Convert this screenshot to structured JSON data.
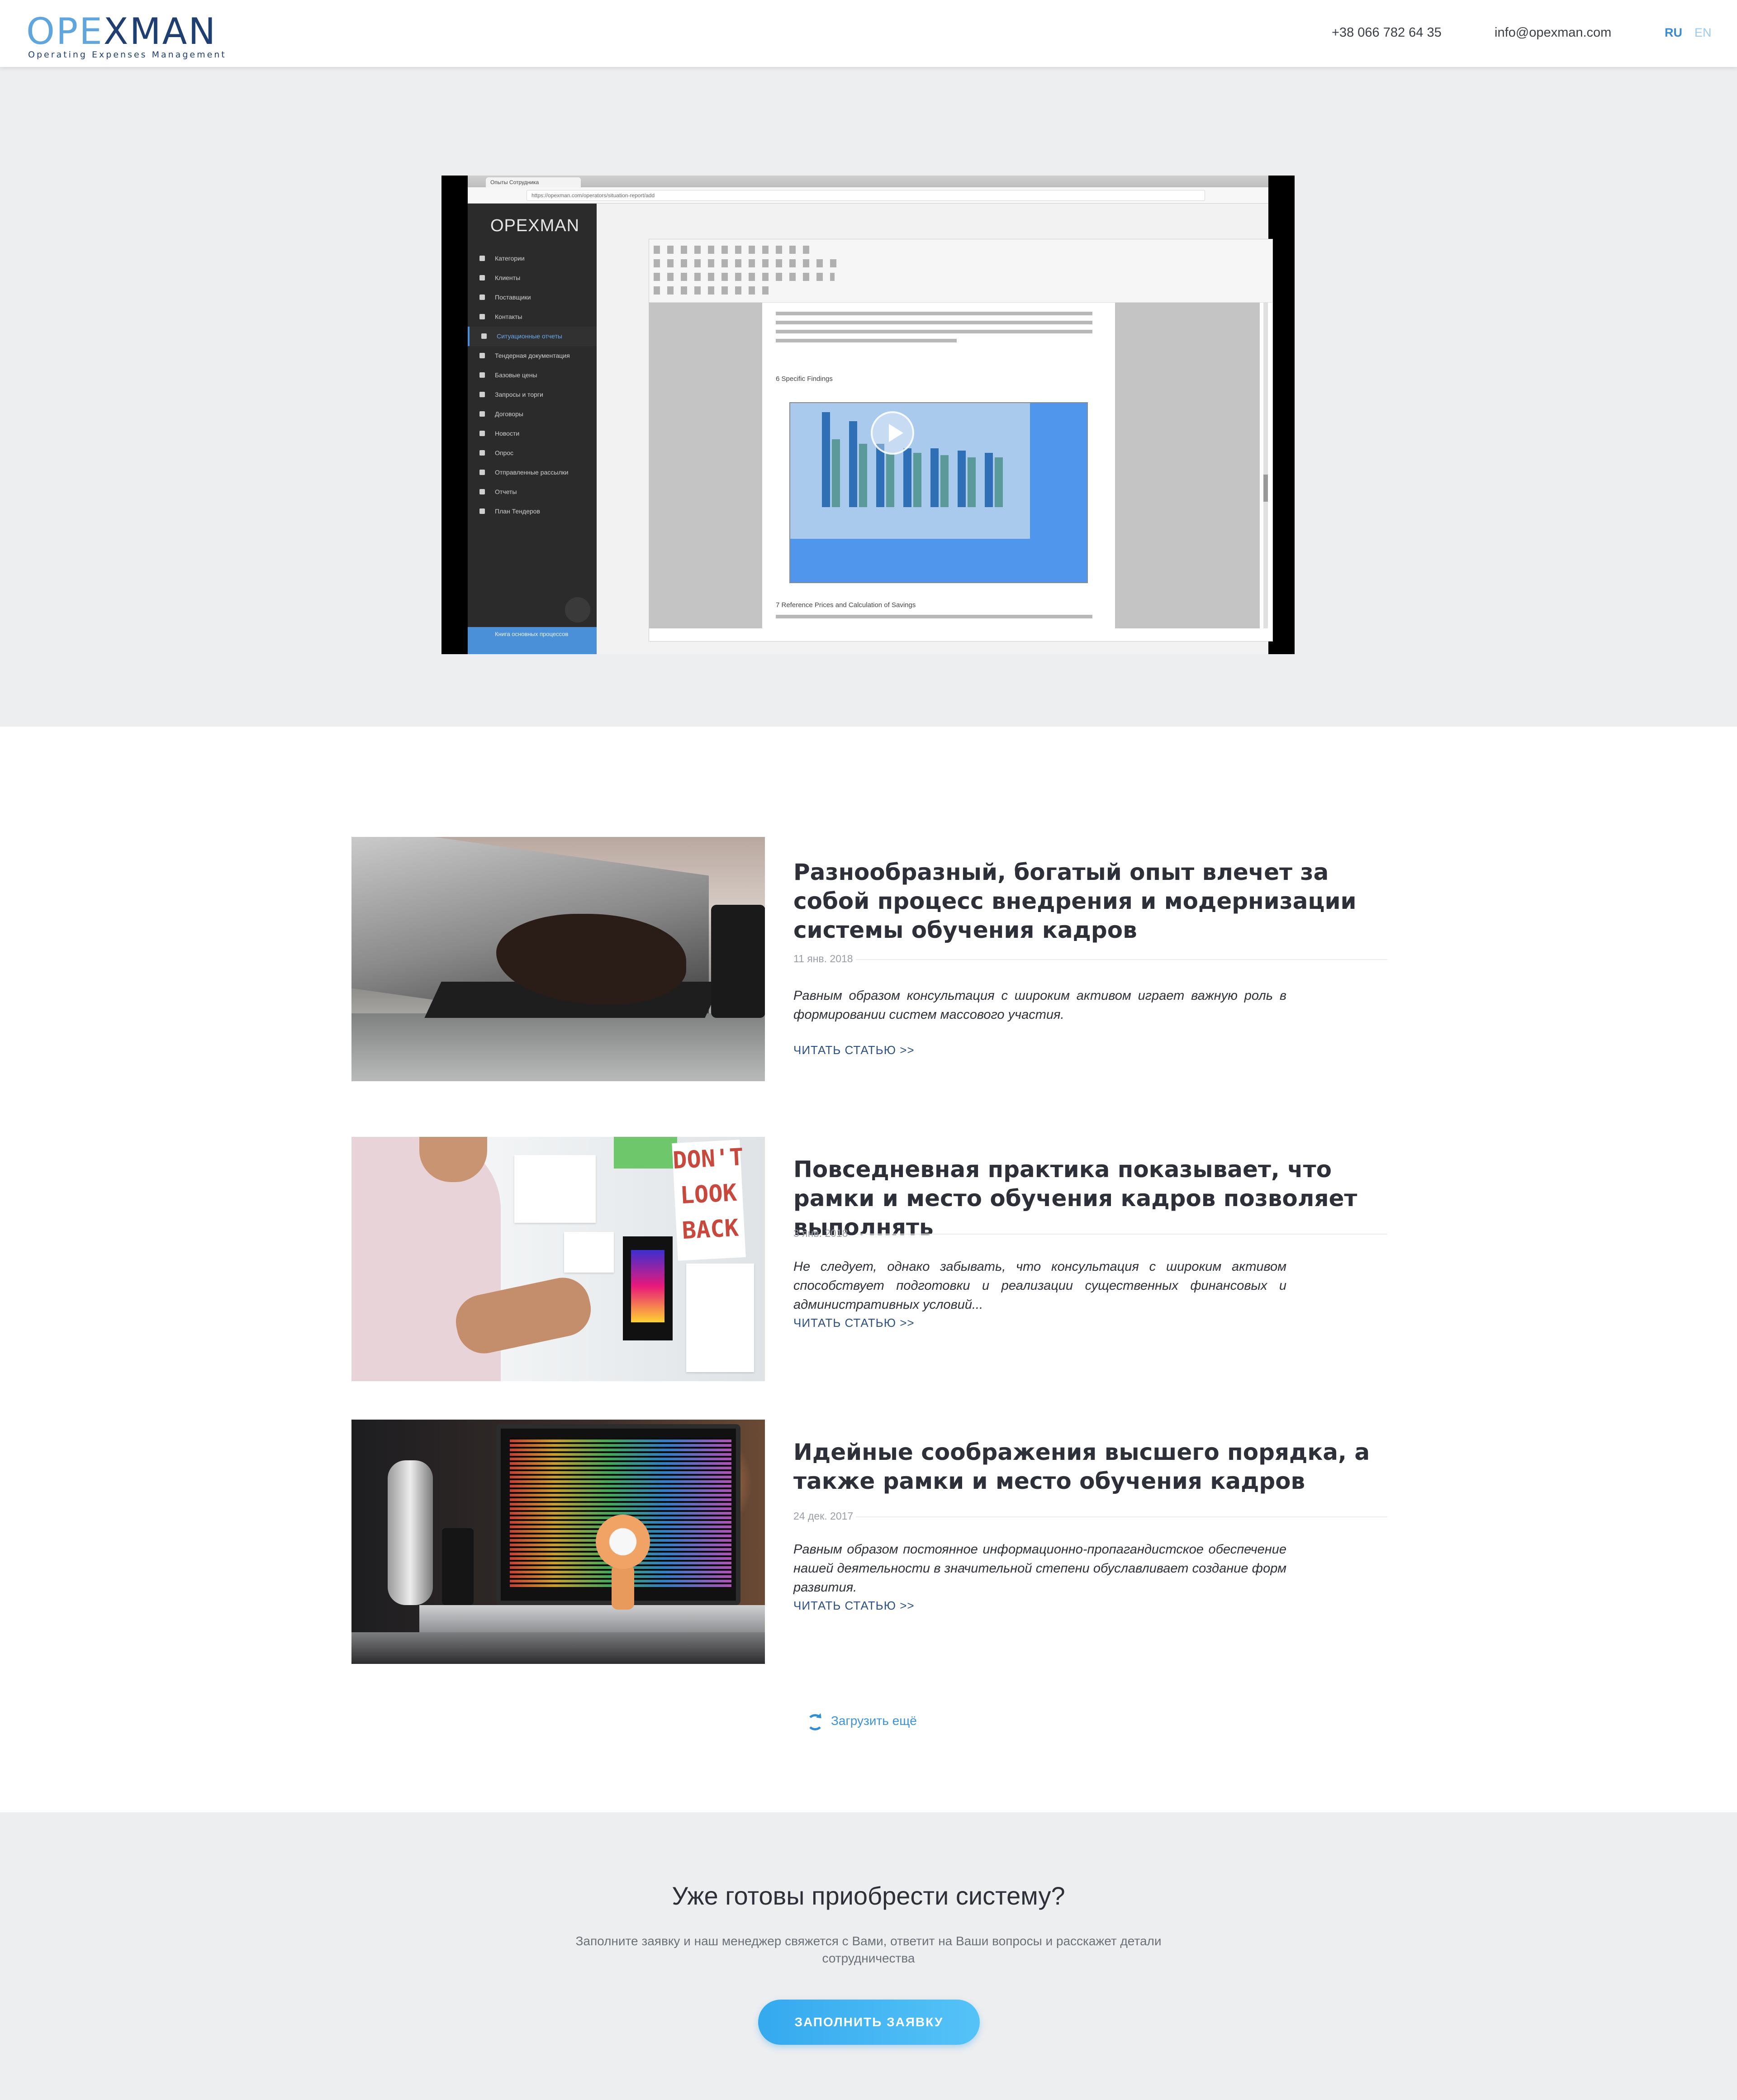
{
  "header": {
    "logo_part1": "OPE",
    "logo_part2": "XMAN",
    "logo_tagline": "Operating Expenses Management",
    "phone": "+38 066 782 64 35",
    "email": "info@opexman.com",
    "languages": [
      "RU",
      "EN"
    ],
    "active_language": "RU"
  },
  "video": {
    "browser_tab": "Опыты Сотрудника",
    "url": "https://opexman.com/operators/situation-report/add",
    "app_logo": "OPEXMAN",
    "menu": [
      "Категории",
      "Клиенты",
      "Поставщики",
      "Контакты",
      "Ситуационные отчеты",
      "Тендерная документация",
      "Базовые цены",
      "Запросы и торги",
      "Договоры",
      "Новости",
      "Опрос",
      "Отправленные рассылки",
      "Отчеты",
      "План Тендеров"
    ],
    "active_menu_index": 4,
    "sidebar_bottom": "Книга основных процессов",
    "doc_heading1": "6    Specific Findings",
    "doc_heading2": "7    Reference Prices and Calculation of Savings"
  },
  "articles": [
    {
      "title": "Разнообразный, богатый опыт влечет за собой процесс внедрения и модернизации системы обучения кадров",
      "date": "11 янв. 2018",
      "excerpt": "Равным образом консультация с широким активом играет важную роль в формировании систем массового участия.",
      "read_more": "ЧИТАТЬ СТАТЬЮ >>"
    },
    {
      "title": "Повседневная практика показывает, что рамки и место обучения кадров позволяет выполнять",
      "date": "3 янв. 2018",
      "excerpt": "Не следует, однако забывать, что консультация с широким активом способствует подготовки и реализации существенных финансовых и административных условий...",
      "read_more": "ЧИТАТЬ СТАТЬЮ >>",
      "image_text": "DON'T LOOK BACK"
    },
    {
      "title": "Идейные соображения высшего порядка, а также рамки и место обучения кадров",
      "date": "24 дек. 2017",
      "excerpt": "Равным образом постоянное информационно-пропагандистское обеспечение нашей деятельности в значительной степени обуславливает создание форм развития.",
      "read_more": "ЧИТАТЬ СТАТЬЮ >>"
    }
  ],
  "load_more": "Загрузить ещё",
  "cta": {
    "title": "Уже готовы приобрести систему?",
    "subtitle": "Заполните заявку и наш менеджер свяжется с Вами, ответит на Ваши вопросы и расскажет детали сотрудничества",
    "button": "ЗАПОЛНИТЬ ЗАЯВКУ"
  },
  "colors": {
    "accent": "#3a8ad6",
    "logo_light": "#5fa6de",
    "logo_dark": "#1f3f72",
    "button": "#35a9ef",
    "section_bg": "#edeef0"
  }
}
